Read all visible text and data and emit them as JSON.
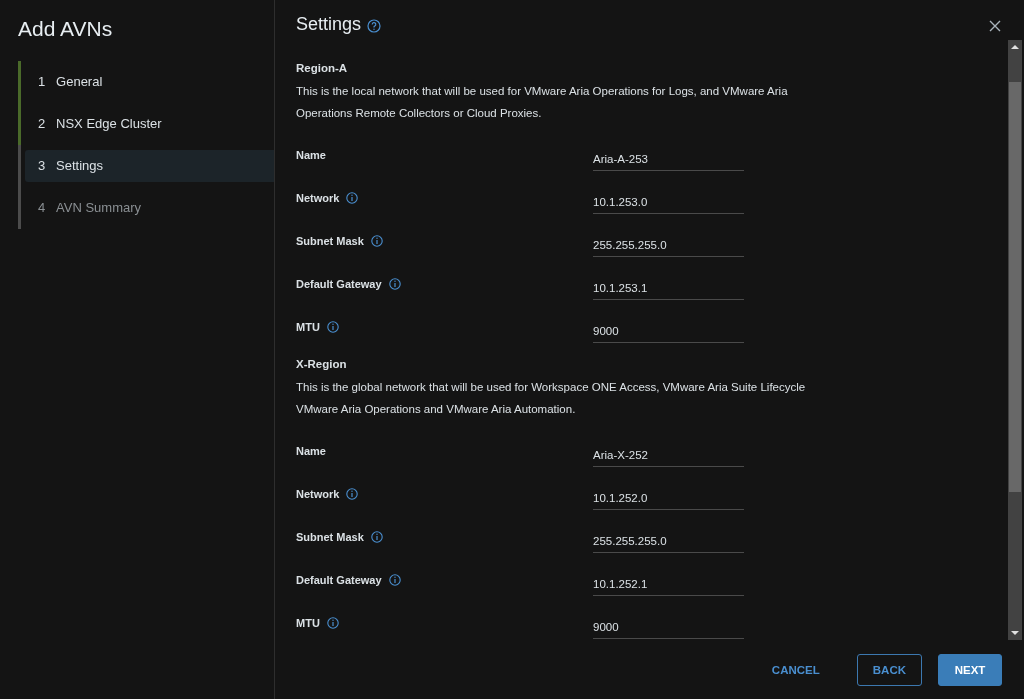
{
  "sidebar": {
    "title": "Add AVNs",
    "steps": [
      {
        "number": "1",
        "label": "General",
        "selected": false,
        "completed": true,
        "disabled": false
      },
      {
        "number": "2",
        "label": "NSX Edge Cluster",
        "selected": false,
        "completed": true,
        "disabled": false
      },
      {
        "number": "3",
        "label": "Settings",
        "selected": true,
        "completed": false,
        "disabled": false
      },
      {
        "number": "4",
        "label": "AVN Summary",
        "selected": false,
        "completed": false,
        "disabled": true
      }
    ]
  },
  "header": {
    "title": "Settings"
  },
  "sections": [
    {
      "heading": "Region-A",
      "description": "This is the local network that will be used for VMware Aria Operations for Logs, and VMware Aria Operations Remote Collectors or Cloud Proxies.",
      "fields": [
        {
          "label": "Name",
          "info": false,
          "value": "Aria-A-253"
        },
        {
          "label": "Network",
          "info": true,
          "value": "10.1.253.0"
        },
        {
          "label": "Subnet Mask",
          "info": true,
          "value": "255.255.255.0"
        },
        {
          "label": "Default Gateway",
          "info": true,
          "value": "10.1.253.1"
        },
        {
          "label": "MTU",
          "info": true,
          "value": "9000"
        }
      ]
    },
    {
      "heading": "X-Region",
      "description": "This is the global network that will be used for Workspace ONE Access, VMware Aria Suite Lifecycle VMware Aria Operations and VMware Aria Automation.",
      "fields": [
        {
          "label": "Name",
          "info": false,
          "value": "Aria-X-252"
        },
        {
          "label": "Network",
          "info": true,
          "value": "10.1.252.0"
        },
        {
          "label": "Subnet Mask",
          "info": true,
          "value": "255.255.255.0"
        },
        {
          "label": "Default Gateway",
          "info": true,
          "value": "10.1.252.1"
        },
        {
          "label": "MTU",
          "info": true,
          "value": "9000"
        }
      ]
    }
  ],
  "footer": {
    "buttons": [
      {
        "label": "CANCEL",
        "kind": "link"
      },
      {
        "label": "BACK",
        "kind": "outline"
      },
      {
        "label": "NEXT",
        "kind": "primary"
      }
    ]
  }
}
